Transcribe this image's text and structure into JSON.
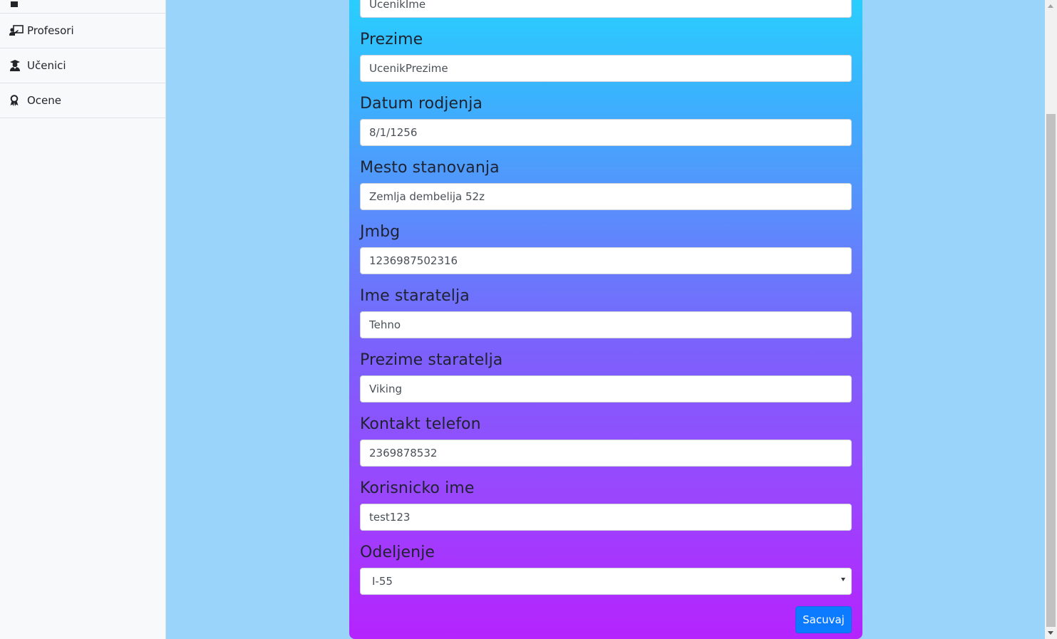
{
  "sidebar": {
    "items": [
      {
        "label": "",
        "icon": "user-square-icon"
      },
      {
        "label": "Profesori",
        "icon": "chalkboard-teacher-icon"
      },
      {
        "label": "Učenici",
        "icon": "user-graduate-icon"
      },
      {
        "label": "Ocene",
        "icon": "award-icon"
      }
    ]
  },
  "form": {
    "fields": [
      {
        "label": "",
        "value": "UcenikIme"
      },
      {
        "label": "Prezime",
        "value": "UcenikPrezime"
      },
      {
        "label": "Datum rodjenja",
        "value": "8/1/1256"
      },
      {
        "label": "Mesto stanovanja",
        "value": "Zemlja dembelija 52z"
      },
      {
        "label": "Jmbg",
        "value": "1236987502316"
      },
      {
        "label": "Ime staratelja",
        "value": "Tehno"
      },
      {
        "label": "Prezime staratelja",
        "value": "Viking"
      },
      {
        "label": "Kontakt telefon",
        "value": "2369878532"
      },
      {
        "label": "Korisnicko ime",
        "value": "test123"
      },
      {
        "label": "Odeljenje",
        "value": "I-55"
      }
    ],
    "save_label": "Sacuvaj"
  },
  "colors": {
    "page_bg": "#9bd4fa",
    "card_gradient_top": "#27d2fe",
    "card_gradient_bottom": "#b523fd",
    "primary_button": "#0d7bff"
  }
}
